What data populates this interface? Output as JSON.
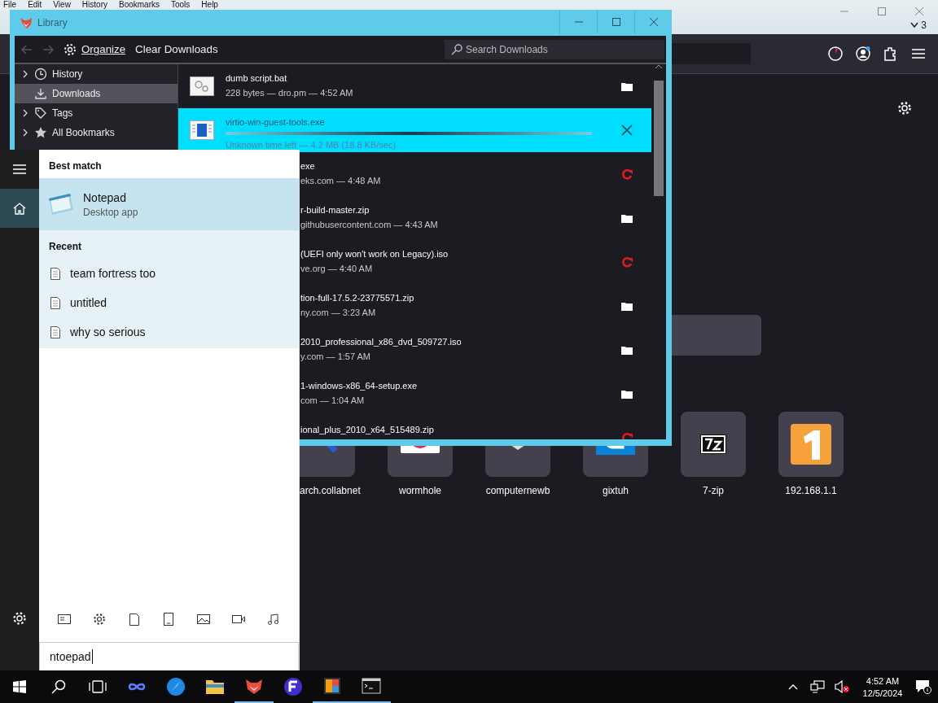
{
  "browser": {
    "menu": [
      "File",
      "Edit",
      "View",
      "History",
      "Bookmarks",
      "Tools",
      "Help"
    ],
    "tab_count": "3",
    "shortcuts": [
      {
        "label": "arch.collabnet",
        "kind": "search"
      },
      {
        "label": "wormhole",
        "kind": "wormhole"
      },
      {
        "label": "computernewb",
        "kind": "box"
      },
      {
        "label": "gixtuh",
        "kind": "g"
      },
      {
        "label": "7-zip",
        "kind": "zip"
      },
      {
        "label": "192.168.1.1",
        "kind": "one"
      }
    ]
  },
  "library": {
    "title": "Library",
    "organize": "Organize",
    "clear": "Clear Downloads",
    "search_placeholder": "Search Downloads",
    "sidebar": [
      {
        "label": "History",
        "kind": "clock",
        "has_children": true,
        "selected": false
      },
      {
        "label": "Downloads",
        "kind": "download",
        "has_children": false,
        "selected": true
      },
      {
        "label": "Tags",
        "kind": "tag",
        "has_children": true,
        "selected": false
      },
      {
        "label": "All Bookmarks",
        "kind": "star",
        "has_children": true,
        "selected": false
      }
    ],
    "downloads": [
      {
        "name": "dumb script.bat",
        "detail": "228 bytes — dro.pm — 4:52 AM",
        "kind": "folder",
        "selected": false
      },
      {
        "name": "virtio-win-guest-tools.exe",
        "detail": "Unknown time left — 4.2 MB (18.8 KB/sec)",
        "kind": "cancel",
        "selected": true
      },
      {
        "name": "exe",
        "detail": "eks.com — 4:48 AM",
        "kind": "retry",
        "selected": false
      },
      {
        "name": "r-build-master.zip",
        "detail": "githubusercontent.com — 4:43 AM",
        "kind": "folder",
        "selected": false
      },
      {
        "name": "(UEFI only won't work on Legacy).iso",
        "detail": "ve.org — 4:40 AM",
        "kind": "retry",
        "selected": false
      },
      {
        "name": "tion-full-17.5.2-23775571.zip",
        "detail": "ny.com — 3:23 AM",
        "kind": "folder",
        "selected": false
      },
      {
        "name": "2010_professional_x86_dvd_509727.iso",
        "detail": "y.com — 1:57 AM",
        "kind": "folder",
        "selected": false
      },
      {
        "name": "1-windows-x86_64-setup.exe",
        "detail": "com — 1:04 AM",
        "kind": "folder",
        "selected": false
      },
      {
        "name": "ional_plus_2010_x64_515489.zip",
        "kind": "retry",
        "selected": false
      }
    ]
  },
  "start": {
    "best_header": "Best match",
    "best": {
      "name": "Notepad",
      "type": "Desktop app"
    },
    "recent_header": "Recent",
    "recent": [
      "team fortress too",
      "untitled",
      "why so serious"
    ],
    "search_value": "ntoepad"
  },
  "taskbar": {
    "apps": [
      {
        "kind": "infinity",
        "open": false
      },
      {
        "kind": "compass",
        "open": false
      },
      {
        "kind": "folder",
        "open": false
      },
      {
        "kind": "fox",
        "open": true
      },
      {
        "kind": "f",
        "open": false
      },
      {
        "kind": "paint",
        "open": true
      },
      {
        "kind": "terminal",
        "open": true
      }
    ],
    "time": "4:52 AM",
    "date": "12/5/2024"
  }
}
